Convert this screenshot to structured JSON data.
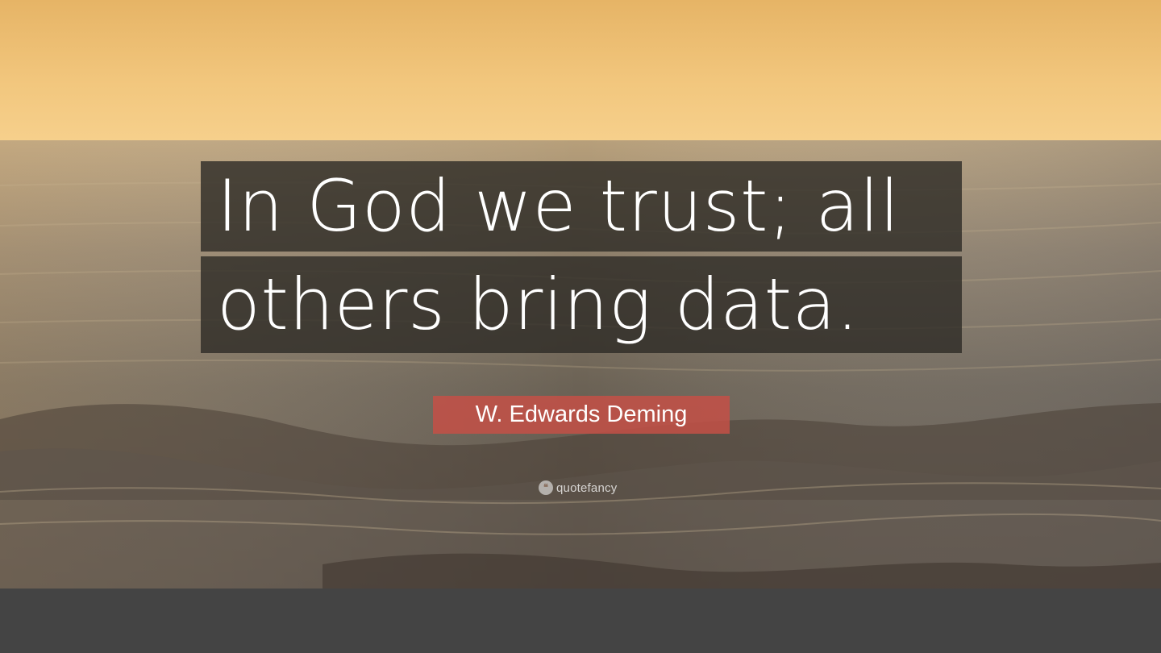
{
  "quote": {
    "line_1": "In God we trust; all",
    "line_2": "others bring data."
  },
  "author": "W. Edwards Deming",
  "brand": {
    "name": "quotefancy",
    "icon": "quote-mark-icon"
  },
  "colors": {
    "sky_top": "#e9b86c",
    "sea": "#6d6a60",
    "quote_box": "#2d2a26",
    "author_box": "#c45046",
    "bottom_bar": "#444444"
  }
}
